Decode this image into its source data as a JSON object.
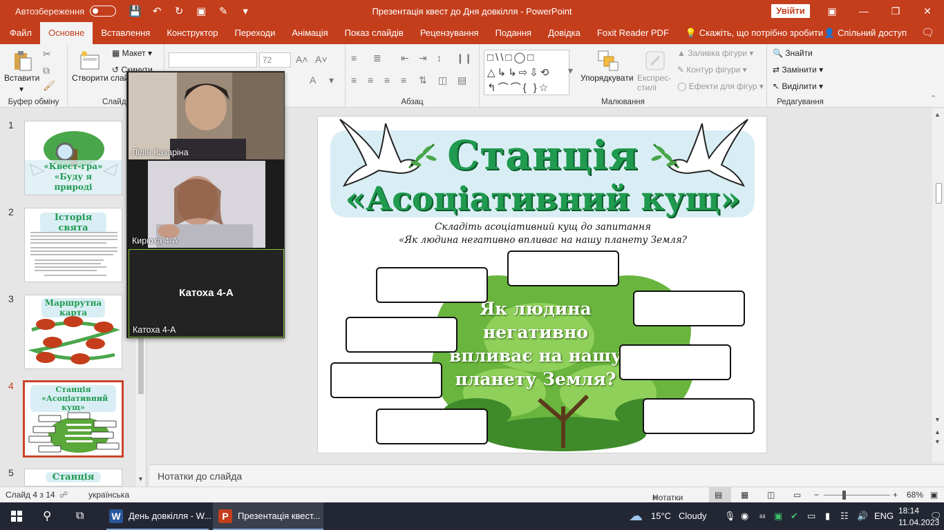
{
  "window": {
    "autosave_label": "Автозбереження",
    "doc_title": "Презентація квест до Дня довкілля - PowerPoint",
    "signin_label": "Увійти"
  },
  "menu": {
    "tabs": [
      "Файл",
      "Основне",
      "Вставлення",
      "Конструктор",
      "Переходи",
      "Анімація",
      "Показ слайдів",
      "Рецензування",
      "Подання",
      "Довідка",
      "Foxit Reader PDF",
      "Скажіть, що потрібно зробити"
    ],
    "active_tab": "Основне",
    "share_label": "Спільний доступ"
  },
  "ribbon": {
    "clipboard": {
      "label": "Буфер обміну",
      "paste": "Вставити"
    },
    "slides": {
      "label": "Слайди",
      "new_slide": "Створити слайд",
      "layout": "Макет",
      "reset": "Скинути"
    },
    "font": {
      "font_name": "",
      "font_size": "72"
    },
    "paragraph": {
      "label": "Абзац"
    },
    "drawing": {
      "label": "Малювання",
      "arrange": "Упорядкувати",
      "quick_styles": "Експрес-стилі",
      "fill": "Заливка фігури",
      "outline": "Контур фігури",
      "effects": "Ефекти для фігур"
    },
    "editing": {
      "label": "Редагування",
      "find": "Знайти",
      "replace": "Замінити",
      "select": "Виділити"
    }
  },
  "thumbnails": [
    {
      "num": "1",
      "title": "«Квест-гра» «Буду я природі другом»"
    },
    {
      "num": "2",
      "title": "Історія свята"
    },
    {
      "num": "3",
      "title": "Маршрутна карта"
    },
    {
      "num": "4",
      "title": "Станція «Асоціативний кущ»",
      "active": true
    },
    {
      "num": "5",
      "title": "Станція"
    }
  ],
  "slide": {
    "title_line1": "Станція",
    "title_line2": "«Асоціативний кущ»",
    "subtitle_line1": "Складіть асоціативний кущ до запитання",
    "subtitle_line2": "«Як людина негативно впливає на нашу планету Земля?",
    "center_text": "Як людина негативно впливає на нашу планету Земля?"
  },
  "video": {
    "participants": [
      {
        "name": "Лілія Казаріна"
      },
      {
        "name": "Кирюха 4-А"
      },
      {
        "name": "Катоха 4-А",
        "center_label": "Катоха 4-А"
      }
    ]
  },
  "notes": {
    "placeholder": "Нотатки до слайда"
  },
  "status": {
    "slide_info": "Слайд 4 з 14",
    "language": "українська",
    "notes_button": "Нотатки",
    "zoom": "68%"
  },
  "taskbar": {
    "word_item": "День довкілля - W...",
    "ppt_item": "Презентація квест...",
    "weather_temp": "15°C",
    "weather_desc": "Cloudy",
    "lang": "ENG",
    "time": "18:14",
    "date": "11.04.2023"
  },
  "colors": {
    "accent": "#c43e1c",
    "title_green": "#1f9a4f",
    "taskbar": "#222733"
  }
}
